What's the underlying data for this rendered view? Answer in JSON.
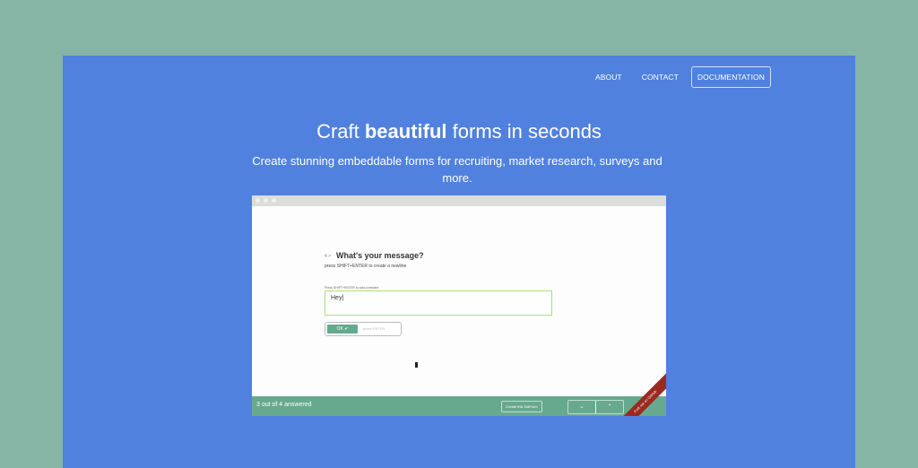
{
  "nav": {
    "about": "ABOUT",
    "contact": "CONTACT",
    "documentation": "DOCUMENTATION"
  },
  "hero": {
    "title_pre": "Craft ",
    "title_bold": "beautiful",
    "title_post": " forms in seconds",
    "subtitle": "Create stunning embeddable forms for recruiting, market research, surveys and more."
  },
  "form": {
    "question_number": "4 >",
    "question_title": "What's your message?",
    "question_hint": "press SHIFT+ENTER to create a newline",
    "field_label": "Press SHIFT+ENTER to add a newline",
    "field_value": "Hey|",
    "ok_label": "OK ✔",
    "ok_hint": "press ENTER"
  },
  "footer": {
    "status": "3 out of 4 answered",
    "create_label": "Create this TailForm",
    "down": "⌄",
    "up": "⌃",
    "ribbon": "Fork me on GitHub"
  }
}
